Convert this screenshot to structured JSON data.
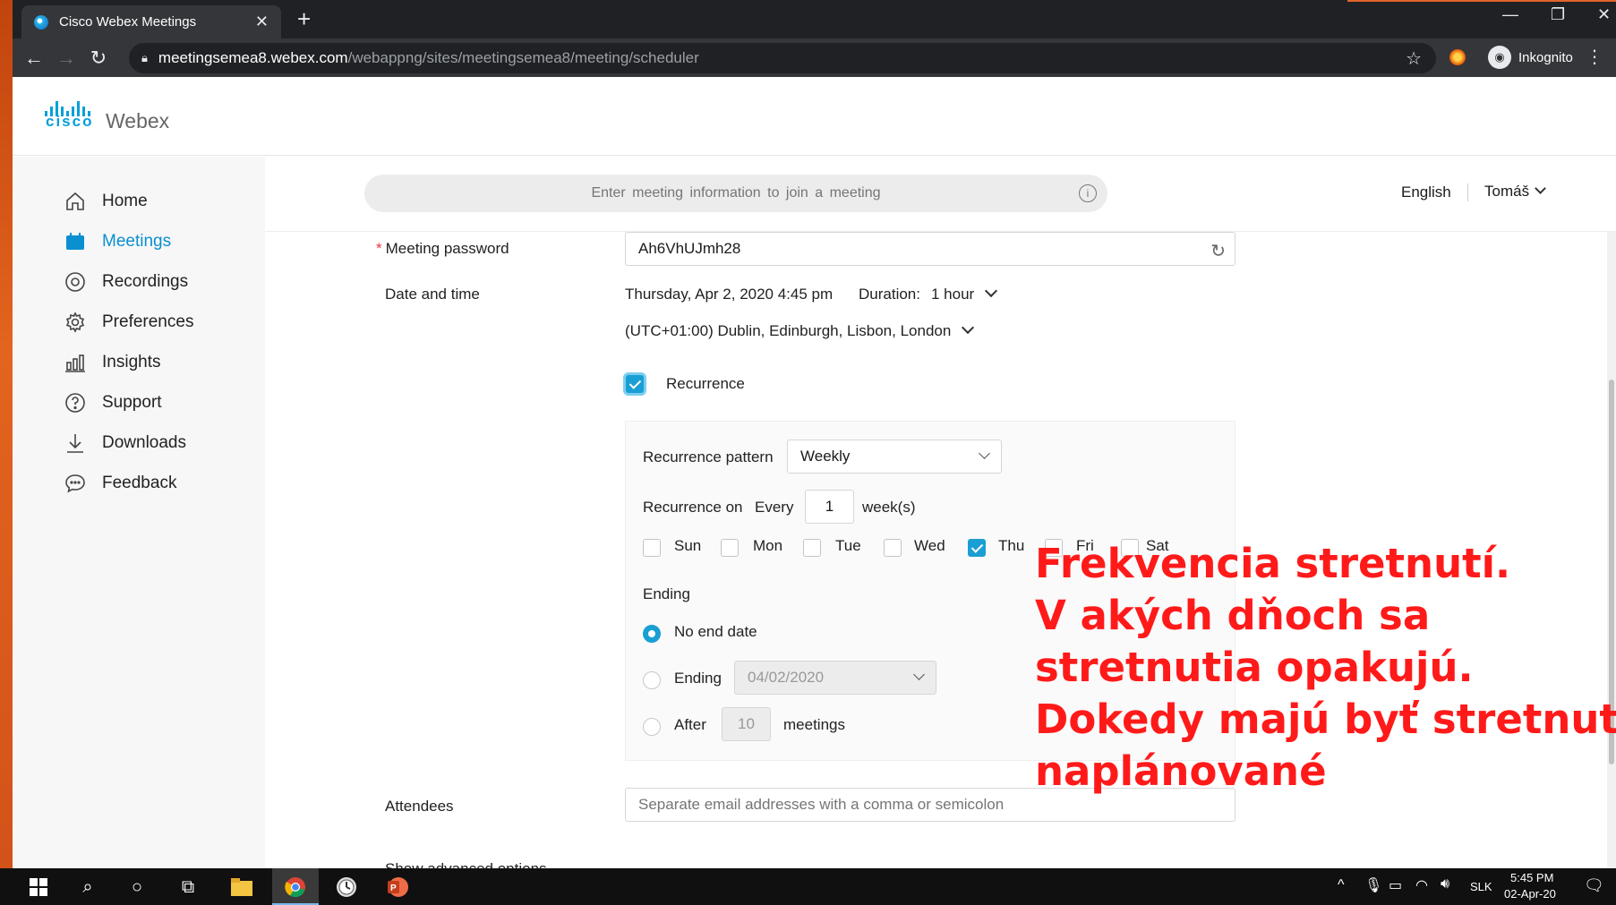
{
  "browser": {
    "tab_title": "Cisco Webex Meetings",
    "tab_close": "✕",
    "new_tab": "+",
    "url_host": "meetingsemea8.webex.com",
    "url_path": "/webappng/sites/meetingsemea8/meeting/scheduler",
    "profile_label": "Inkognito",
    "win_minimize": "—",
    "win_restore": "❐",
    "win_close": "✕"
  },
  "header": {
    "logo_cisco": "cisco",
    "logo_webex": "Webex"
  },
  "sidebar": {
    "items": [
      {
        "label": "Home",
        "icon": "home-icon",
        "active": false
      },
      {
        "label": "Meetings",
        "icon": "meetings-icon",
        "active": true
      },
      {
        "label": "Recordings",
        "icon": "recordings-icon",
        "active": false
      },
      {
        "label": "Preferences",
        "icon": "gear-icon",
        "active": false
      },
      {
        "label": "Insights",
        "icon": "insights-icon",
        "active": false
      },
      {
        "label": "Support",
        "icon": "help-icon",
        "active": false
      },
      {
        "label": "Downloads",
        "icon": "download-icon",
        "active": false
      },
      {
        "label": "Feedback",
        "icon": "feedback-icon",
        "active": false
      }
    ]
  },
  "topbar": {
    "join_placeholder": "Enter meeting information to join a meeting",
    "language": "English",
    "user": "Tomáš"
  },
  "form": {
    "password_label": "Meeting password",
    "password_value": "Ah6VhUJmh28",
    "datetime_label": "Date and time",
    "datetime_value": "Thursday, Apr 2, 2020 4:45 pm",
    "duration_label": "Duration:",
    "duration_value": "1 hour",
    "timezone": "(UTC+01:00) Dublin, Edinburgh, Lisbon, London",
    "recurrence_label": "Recurrence",
    "recurrence_checked": true,
    "pattern_label": "Recurrence pattern",
    "pattern_value": "Weekly",
    "recurrence_on_label": "Recurrence on",
    "every_label": "Every",
    "every_value": "1",
    "weeks_label": "week(s)",
    "days": [
      {
        "label": "Sun",
        "checked": false
      },
      {
        "label": "Mon",
        "checked": false
      },
      {
        "label": "Tue",
        "checked": false
      },
      {
        "label": "Wed",
        "checked": false
      },
      {
        "label": "Thu",
        "checked": true
      },
      {
        "label": "Fri",
        "checked": false
      },
      {
        "label": "Sat",
        "checked": false
      }
    ],
    "ending_label": "Ending",
    "no_end_label": "No end date",
    "ending_option_label": "Ending",
    "ending_date": "04/02/2020",
    "after_label": "After",
    "after_value": "10",
    "meetings_label": "meetings",
    "attendees_label": "Attendees",
    "attendees_placeholder": "Separate email addresses with a comma or semicolon",
    "advanced_label": "Show advanced options"
  },
  "annotation": {
    "lines": [
      "Frekvencia stretnutí.",
      "V akých dňoch sa",
      "stretnutia opakujú.",
      "Dokedy majú byť stretnutia",
      "naplánované"
    ],
    "color": "#ff1a1a"
  },
  "taskbar": {
    "language": "SLK",
    "time": "5:45 PM",
    "date": "02-Apr-20"
  }
}
